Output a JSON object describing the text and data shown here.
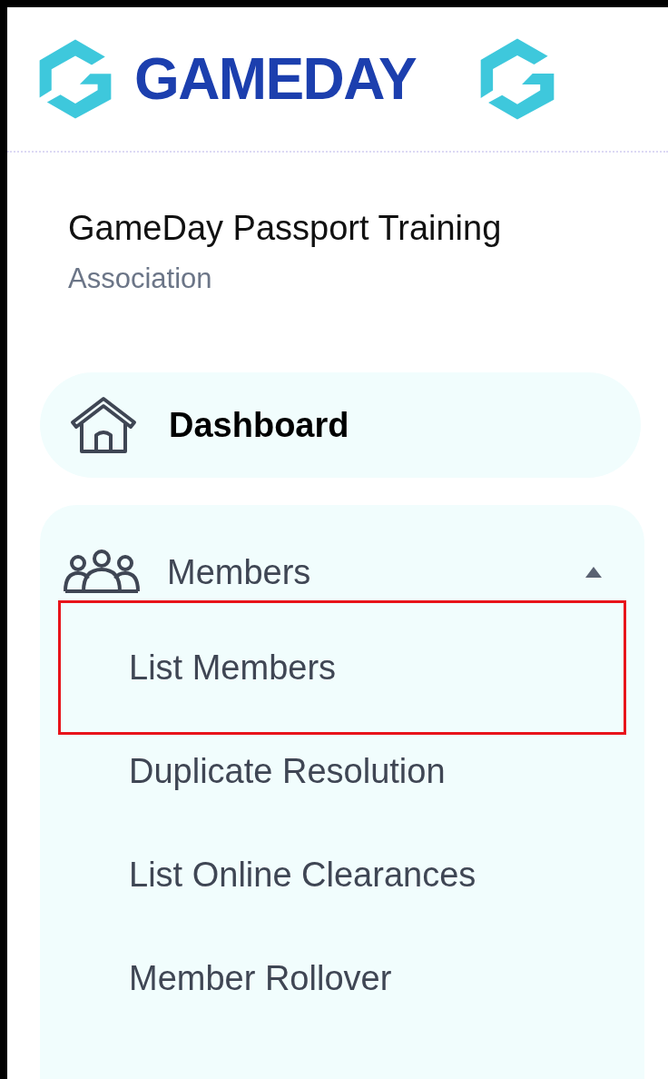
{
  "brand": {
    "wordmark": "GAMEDAY"
  },
  "organisation": {
    "name": "GameDay Passport Training",
    "type": "Association"
  },
  "nav": [
    {
      "kind": "link",
      "label": "Dashboard",
      "selected": true
    },
    {
      "kind": "group",
      "label": "Members",
      "expanded": true,
      "children": [
        {
          "label": "List Members",
          "highlighted": true
        },
        {
          "label": "Duplicate Resolution",
          "highlighted": false
        },
        {
          "label": "List Online Clearances",
          "highlighted": false
        },
        {
          "label": "Member Rollover",
          "highlighted": false
        }
      ]
    }
  ]
}
